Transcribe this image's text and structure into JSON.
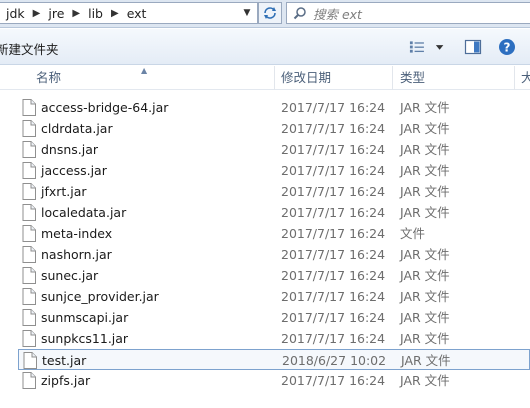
{
  "address": {
    "crumbs": [
      "jdk",
      "jre",
      "lib",
      "ext"
    ],
    "dropdown_glyph": "▼"
  },
  "search": {
    "placeholder": "搜索 ext"
  },
  "toolbar": {
    "new_folder_label": "新建文件夹"
  },
  "columns": {
    "name": "名称",
    "date": "修改日期",
    "type": "类型",
    "size": "大"
  },
  "files": [
    {
      "name": "access-bridge-64.jar",
      "date": "2017/7/17 16:24",
      "type": "JAR 文件"
    },
    {
      "name": "cldrdata.jar",
      "date": "2017/7/17 16:24",
      "type": "JAR 文件"
    },
    {
      "name": "dnsns.jar",
      "date": "2017/7/17 16:24",
      "type": "JAR 文件"
    },
    {
      "name": "jaccess.jar",
      "date": "2017/7/17 16:24",
      "type": "JAR 文件"
    },
    {
      "name": "jfxrt.jar",
      "date": "2017/7/17 16:24",
      "type": "JAR 文件"
    },
    {
      "name": "localedata.jar",
      "date": "2017/7/17 16:24",
      "type": "JAR 文件"
    },
    {
      "name": "meta-index",
      "date": "2017/7/17 16:24",
      "type": "文件"
    },
    {
      "name": "nashorn.jar",
      "date": "2017/7/17 16:24",
      "type": "JAR 文件"
    },
    {
      "name": "sunec.jar",
      "date": "2017/7/17 16:24",
      "type": "JAR 文件"
    },
    {
      "name": "sunjce_provider.jar",
      "date": "2017/7/17 16:24",
      "type": "JAR 文件"
    },
    {
      "name": "sunmscapi.jar",
      "date": "2017/7/17 16:24",
      "type": "JAR 文件"
    },
    {
      "name": "sunpkcs11.jar",
      "date": "2017/7/17 16:24",
      "type": "JAR 文件"
    },
    {
      "name": "test.jar",
      "date": "2018/6/27 10:02",
      "type": "JAR 文件",
      "selected": true
    },
    {
      "name": "zipfs.jar",
      "date": "2017/7/17 16:24",
      "type": "JAR 文件"
    }
  ],
  "colors": {
    "selection_border": "#7da2ce",
    "header_text": "#4c607a",
    "toolbar_bg": "#e4ecf6"
  }
}
